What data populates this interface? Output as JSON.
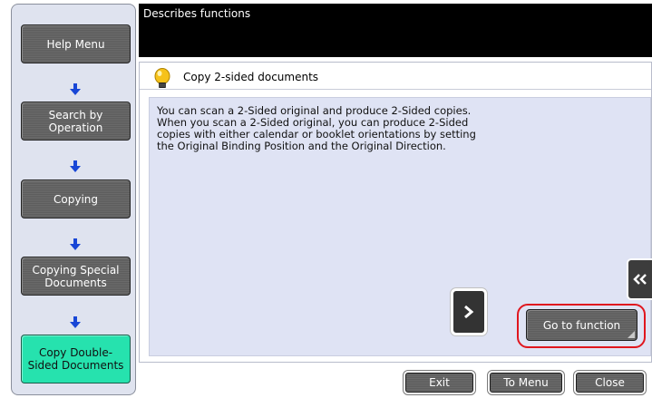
{
  "header": {
    "title": "Describes functions"
  },
  "nav": {
    "items": [
      {
        "label": "Help Menu"
      },
      {
        "label": "Search by\nOperation"
      },
      {
        "label": "Copying"
      },
      {
        "label": "Copying Special\nDocuments"
      },
      {
        "label": "Copy Double-\nSided Documents",
        "active": true
      }
    ]
  },
  "panel": {
    "title": "Copy 2-sided documents",
    "body": "You can scan a 2-Sided original and produce 2-Sided copies. When you scan a 2-Sided original, you can produce 2-Sided copies with either calendar or booklet orientations by setting the Original Binding Position and the Original Direction."
  },
  "actions": {
    "go_to_function": "Go to function"
  },
  "footer": {
    "exit": "Exit",
    "to_menu": "To Menu",
    "close": "Close"
  },
  "colors": {
    "active_nav": "#26e2ae",
    "highlight": "#e0161e",
    "nav_arrow": "#1846d6"
  }
}
